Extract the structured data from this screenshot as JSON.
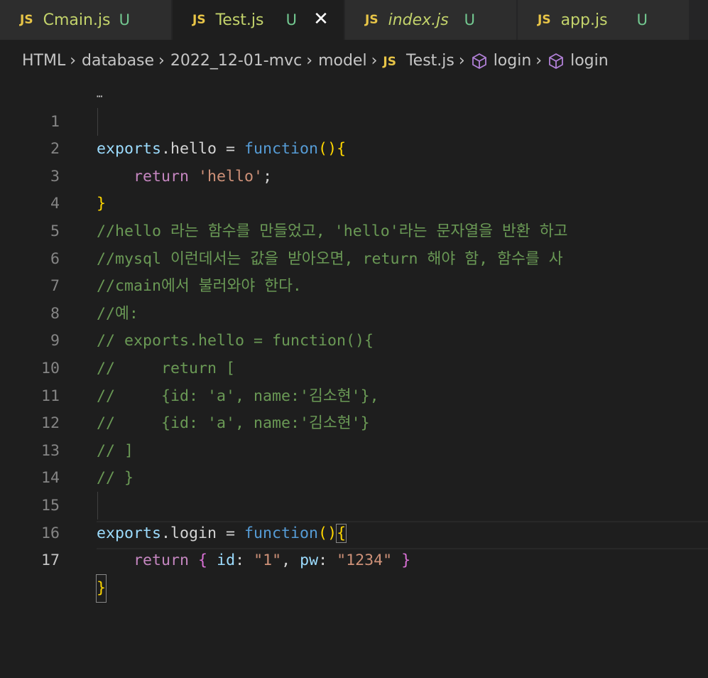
{
  "tabs": [
    {
      "badge": "JS",
      "name": "Cmain.js",
      "status": "U",
      "active": false,
      "italic": false
    },
    {
      "badge": "JS",
      "name": "Test.js",
      "status": "U",
      "active": true,
      "italic": false,
      "close": "✕"
    },
    {
      "badge": "JS",
      "name": "index.js",
      "status": "U",
      "active": false,
      "italic": true
    },
    {
      "badge": "JS",
      "name": "app.js",
      "status": "U",
      "active": false,
      "italic": false
    }
  ],
  "breadcrumb": {
    "items": [
      "HTML",
      "database",
      "2022_12-01-mvc",
      "model"
    ],
    "file_badge": "JS",
    "file": "Test.js",
    "symbol1": "login",
    "symbol2": "login"
  },
  "editor": {
    "current_line": 17,
    "lines": [
      {
        "n": "1"
      },
      {
        "n": "2"
      },
      {
        "n": "3"
      },
      {
        "n": "4"
      },
      {
        "n": "5"
      },
      {
        "n": "6"
      },
      {
        "n": "7"
      },
      {
        "n": "8"
      },
      {
        "n": "9"
      },
      {
        "n": "10"
      },
      {
        "n": "11"
      },
      {
        "n": "12"
      },
      {
        "n": "13"
      },
      {
        "n": "14"
      },
      {
        "n": "15"
      },
      {
        "n": "16"
      },
      {
        "n": "17"
      }
    ],
    "code": {
      "l1": [
        "exports",
        ".hello = ",
        "function",
        "(",
        ")",
        "{"
      ],
      "l2": [
        "    ",
        "return",
        " ",
        "'hello'",
        ";"
      ],
      "l3": "}",
      "l4": "//hello 라는 함수를 만들었고, 'hello'라는 문자열을 반환 하고",
      "l5": "//mysql 이런데서는 값을 받아오면, return 해야 함, 함수를 사",
      "l6": "//cmain에서 불러와야 한다.",
      "l7": "//예:",
      "l8": "// exports.hello = function(){",
      "l9": "//     return [",
      "l10": "//     {id: 'a', name:'김소현'},",
      "l11": "//     {id: 'a', name:'김소현'}",
      "l12": "// ]",
      "l13": "// }",
      "l15": [
        "exports",
        ".login = ",
        "function",
        "(",
        ")",
        "{"
      ],
      "l16": [
        "    ",
        "return",
        " ",
        "{",
        " ",
        "id",
        ": ",
        "\"1\"",
        ", ",
        "pw",
        ": ",
        "\"1234\"",
        " ",
        "}"
      ],
      "l17": "}"
    }
  },
  "colors": {
    "background": "#1e1e1e",
    "tab_inactive": "#2d2d2d",
    "untracked": "#73c991",
    "js_badge": "#e8c547",
    "keyword": "#c586c0",
    "function": "#569cd6",
    "variable": "#9cdcfe",
    "string": "#ce9178",
    "comment": "#6a9955"
  }
}
